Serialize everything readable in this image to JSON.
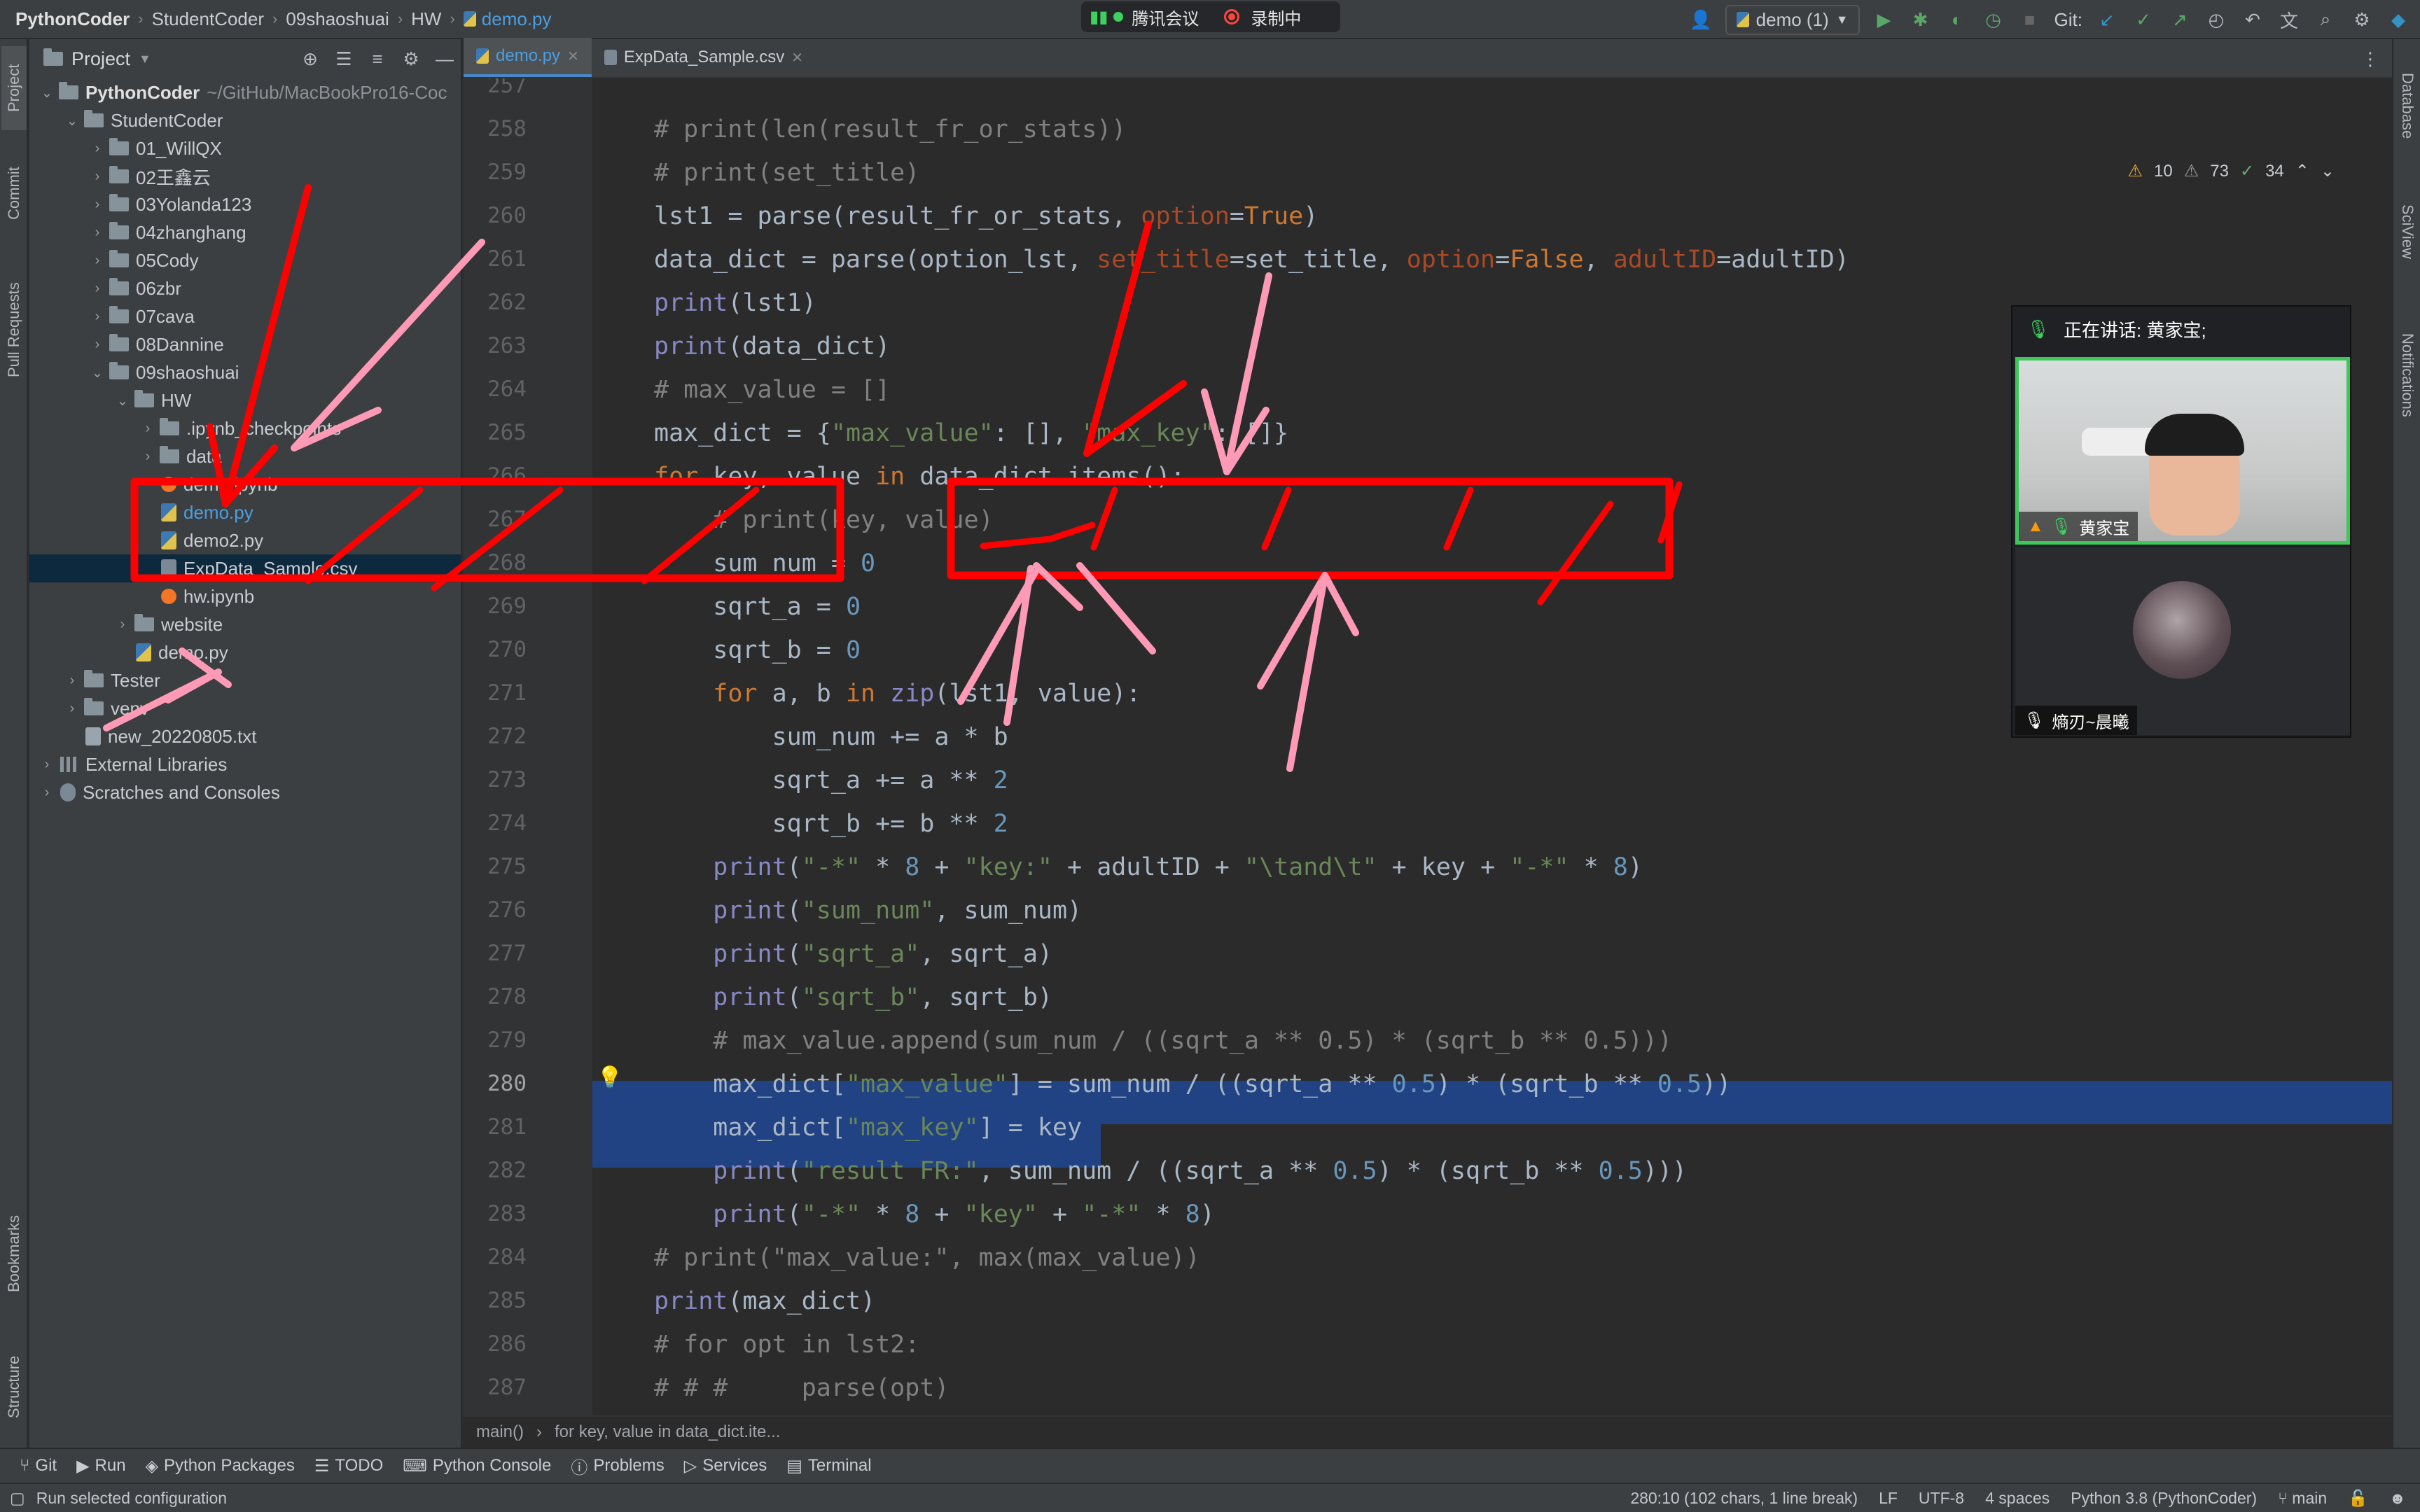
{
  "breadcrumb": [
    "PythonCoder",
    "StudentCoder",
    "09shaoshuai",
    "HW",
    "demo.py"
  ],
  "meeting": {
    "app": "腾讯会议",
    "recording": "录制中",
    "speaking": "正在讲话: 黄家宝;",
    "participant1": "黄家宝",
    "participant2": "熵刃~晨曦"
  },
  "toolbar_top": {
    "run_config": "demo (1)",
    "git_label": "Git:"
  },
  "project": {
    "title": "Project",
    "root": "PythonCoder",
    "root_path": "~/GitHub/MacBookPro16-Coc",
    "items": [
      {
        "label": "StudentCoder"
      },
      {
        "label": "01_WillQX"
      },
      {
        "label": "02王鑫云"
      },
      {
        "label": "03Yolanda123"
      },
      {
        "label": "04zhanghang"
      },
      {
        "label": "05Cody"
      },
      {
        "label": "06zbr"
      },
      {
        "label": "07cava"
      },
      {
        "label": "08Dannine"
      },
      {
        "label": "09shaoshuai"
      },
      {
        "label": "HW"
      },
      {
        "label": ".ipynb_checkpoints"
      },
      {
        "label": "data"
      },
      {
        "label": "demo.ipynb"
      },
      {
        "label": "demo.py"
      },
      {
        "label": "demo2.py"
      },
      {
        "label": "ExpData_Sample.csv"
      },
      {
        "label": "hw.ipynb"
      },
      {
        "label": "website"
      },
      {
        "label": "demo.py"
      },
      {
        "label": "Tester"
      },
      {
        "label": "venv"
      },
      {
        "label": "new_20220805.txt"
      },
      {
        "label": "External Libraries"
      },
      {
        "label": "Scratches and Consoles"
      }
    ]
  },
  "tabs": [
    {
      "label": "demo.py"
    },
    {
      "label": "ExpData_Sample.csv"
    }
  ],
  "inspections": {
    "warn1": "10",
    "warn2": "73",
    "ok": "34"
  },
  "editor": {
    "lines": [
      "257",
      "258",
      "259",
      "260",
      "261",
      "262",
      "263",
      "264",
      "265",
      "266",
      "267",
      "268",
      "269",
      "270",
      "271",
      "272",
      "273",
      "274",
      "275",
      "276",
      "277",
      "278",
      "279",
      "280",
      "281",
      "282",
      "283",
      "284",
      "285",
      "286",
      "287"
    ]
  },
  "code_breadcrumb": [
    "main()",
    "for key, value in data_dict.ite..."
  ],
  "side_tabs_left": [
    "Project",
    "Commit",
    "Pull Requests",
    "Bookmarks",
    "Structure"
  ],
  "side_tabs_right": [
    "Database",
    "SciView",
    "Notifications"
  ],
  "bottom_tools": [
    "Git",
    "Run",
    "Python Packages",
    "TODO",
    "Python Console",
    "Problems",
    "Services",
    "Terminal"
  ],
  "status": {
    "message": "Run selected configuration",
    "position": "280:10 (102 chars, 1 line break)",
    "eol": "LF",
    "encoding": "UTF-8",
    "indent": "4 spaces",
    "interpreter": "Python 3.8 (PythonCoder)",
    "branch": "main"
  }
}
